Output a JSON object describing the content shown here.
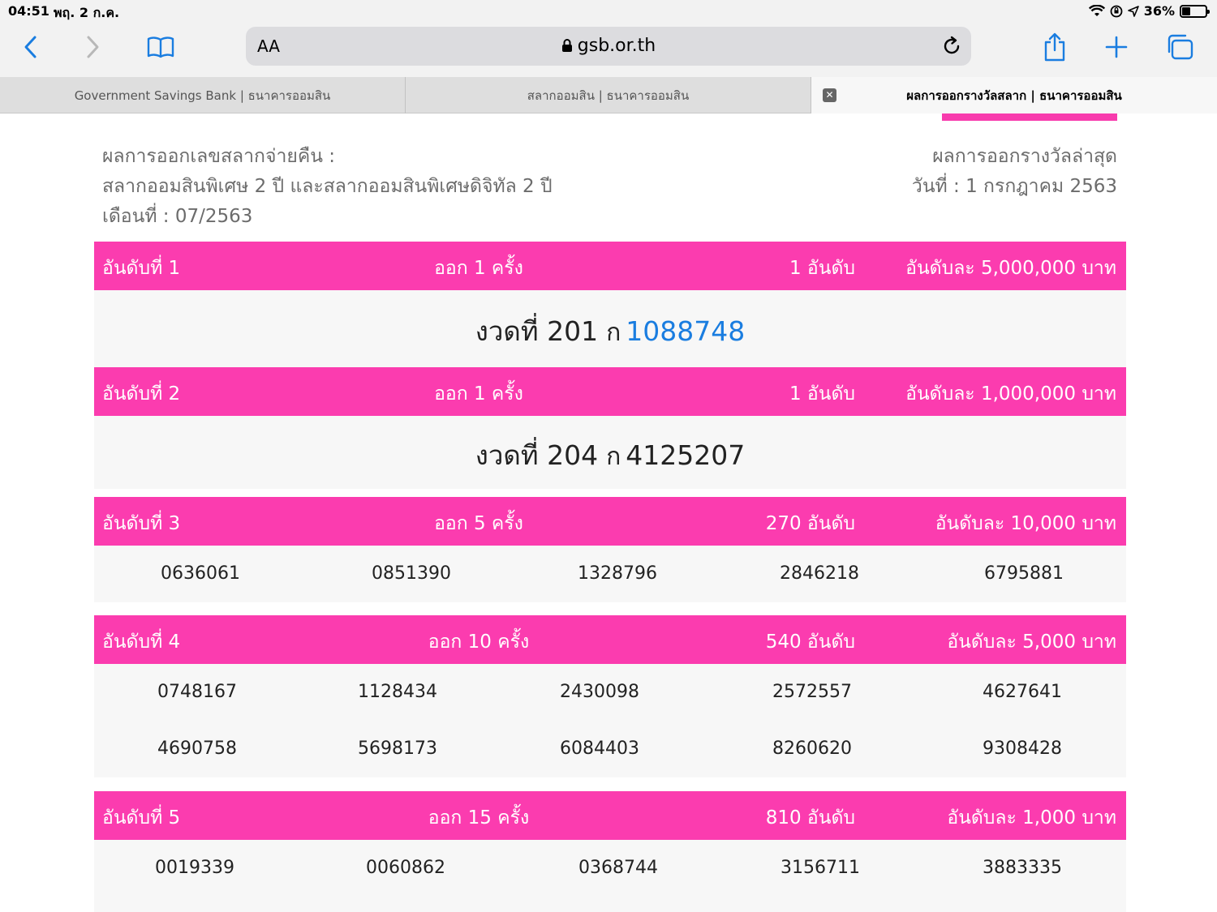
{
  "statusbar": {
    "time": "04:51",
    "date": "พฤ. 2 ก.ค.",
    "battery": "36%"
  },
  "toolbar": {
    "text_size": "AA",
    "url": "gsb.or.th"
  },
  "tabs": [
    {
      "label": "Government Savings Bank | ธนาคารออมสิน"
    },
    {
      "label": "สลากออมสิน | ธนาคารออมสิน"
    },
    {
      "label": "ผลการออกรางวัลสลาก | ธนาคารออมสิน"
    }
  ],
  "info": {
    "left_line1": "ผลการออกเลขสลากจ่ายคืน :",
    "left_line2": "สลากออมสินพิเศษ 2 ปี และสลากออมสินพิเศษดิจิทัล 2 ปี",
    "left_line3": "เดือนที่ : 07/2563",
    "right_line1": "ผลการออกรางวัลล่าสุด",
    "right_line2": "วันที่ : 1 กรกฎาคม 2563"
  },
  "prizes": [
    {
      "rank": "อันดับที่ 1",
      "times": "ออก 1 ครั้ง",
      "count": "1 อันดับ",
      "amount": "อันดับละ 5,000,000 บาท",
      "draw_prefix": "งวดที่ 201",
      "draw_series": "ก",
      "number": "1088748"
    },
    {
      "rank": "อันดับที่ 2",
      "times": "ออก 1 ครั้ง",
      "count": "1 อันดับ",
      "amount": "อันดับละ 1,000,000 บาท",
      "draw_prefix": "งวดที่ 204",
      "draw_series": "ก",
      "number": "4125207"
    },
    {
      "rank": "อันดับที่ 3",
      "times": "ออก 5 ครั้ง",
      "count": "270 อันดับ",
      "amount": "อันดับละ 10,000 บาท",
      "numbers": [
        "0636061",
        "0851390",
        "1328796",
        "2846218",
        "6795881"
      ]
    },
    {
      "rank": "อันดับที่ 4",
      "times": "ออก 10 ครั้ง",
      "count": "540 อันดับ",
      "amount": "อันดับละ 5,000 บาท",
      "numbers": [
        "0748167",
        "1128434",
        "2430098",
        "2572557",
        "4627641",
        "4690758",
        "5698173",
        "6084403",
        "8260620",
        "9308428"
      ]
    },
    {
      "rank": "อันดับที่ 5",
      "times": "ออก 15 ครั้ง",
      "count": "810 อันดับ",
      "amount": "อันดับละ 1,000 บาท",
      "numbers": [
        "0019339",
        "0060862",
        "0368744",
        "3156711",
        "3883335"
      ]
    }
  ],
  "colors": {
    "accent": "#fb3caf",
    "link": "#1a7de0"
  }
}
